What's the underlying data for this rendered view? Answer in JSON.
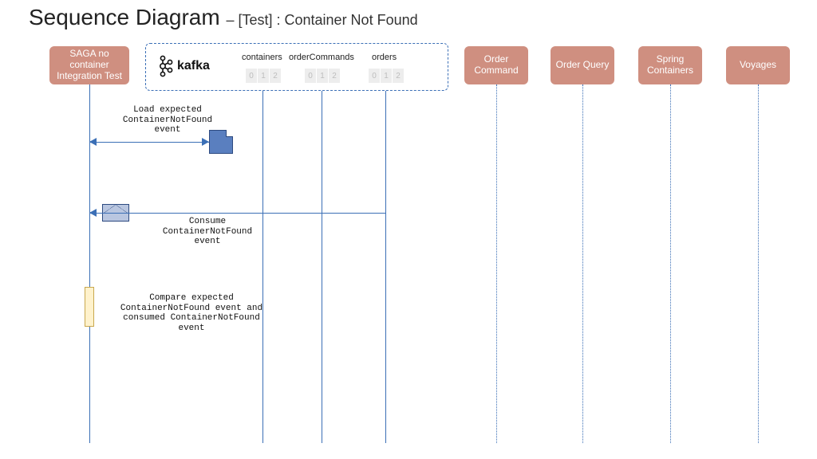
{
  "title_main": "Sequence Diagram",
  "title_sub": "– [Test] : Container Not Found",
  "participants": {
    "saga": "SAGA no container Integration Test",
    "order_command": "Order Command",
    "order_query": "Order Query",
    "spring_containers": "Spring Containers",
    "voyages": "Voyages"
  },
  "kafka": {
    "label": "kafka",
    "topics": {
      "containers": "containers",
      "orderCommands": "orderCommands",
      "orders": "orders"
    },
    "partitions": [
      "0",
      "1",
      "2"
    ]
  },
  "messages": {
    "load": "Load expected\nContainerNotFound\nevent",
    "consume": "Consume\nContainerNotFound\nevent",
    "compare": "Compare expected\nContainerNotFound event and\nconsumed ContainerNotFound event"
  }
}
